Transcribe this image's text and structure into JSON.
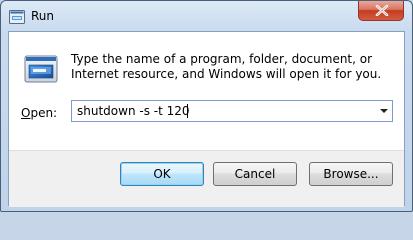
{
  "window": {
    "title": "Run",
    "icons": {
      "app": "run-icon",
      "close": "close-icon",
      "dialog": "run-program-icon",
      "dropdown": "chevron-down-icon"
    }
  },
  "dialog": {
    "description": "Type the name of a program, folder, document, or Internet resource, and Windows will open it for you.",
    "open_label": "Open:",
    "open_value": "shutdown -s -t 120"
  },
  "buttons": {
    "ok": "OK",
    "cancel": "Cancel",
    "browse": "Browse..."
  },
  "colors": {
    "default_button_border": "#3c7fb1",
    "close_button": "#c43c1f"
  }
}
